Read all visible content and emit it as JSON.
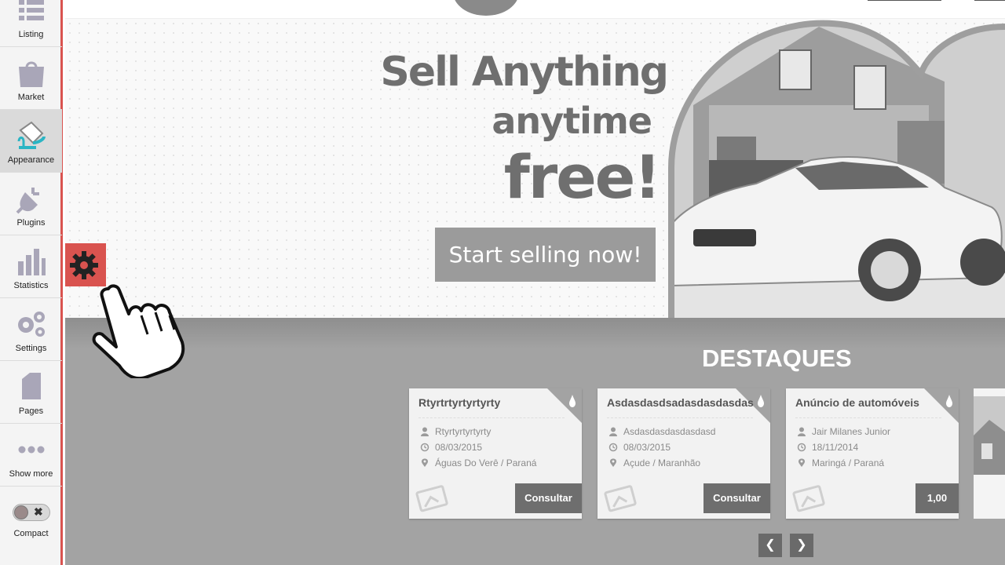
{
  "sidebar": {
    "items": [
      {
        "label": "Listing",
        "icon": "list-icon"
      },
      {
        "label": "Market",
        "icon": "shopping-bag-icon"
      },
      {
        "label": "Appearance",
        "icon": "paint-bucket-icon",
        "active": true
      },
      {
        "label": "Plugins",
        "icon": "plug-icon"
      },
      {
        "label": "Statistics",
        "icon": "bar-chart-icon"
      },
      {
        "label": "Settings",
        "icon": "gears-icon"
      },
      {
        "label": "Pages",
        "icon": "page-icon"
      },
      {
        "label": "Show more",
        "icon": "dots-icon"
      }
    ],
    "compact": {
      "label": "Compact",
      "toggle_symbol": "✖",
      "state": "off"
    }
  },
  "hero": {
    "line1": "Sell Anything",
    "line2": "anytime",
    "line3": "free!",
    "cta": "Start selling now!"
  },
  "featured": {
    "title": "DESTAQUES",
    "cards": [
      {
        "title": "Rtyrtrtyrtyrtyrty",
        "author": "Rtyrtyrtyrtyrty",
        "date": "08/03/2015",
        "location": "Águas Do Verê / Paraná",
        "action": "Consultar"
      },
      {
        "title": "Asdasdasdsadasdasdasdas",
        "author": "Asdasdasdasdasdasd",
        "date": "08/03/2015",
        "location": "Açude / Maranhão",
        "action": "Consultar"
      },
      {
        "title": "Anúncio de automóveis",
        "author": "Jair Milanes Junior",
        "date": "18/11/2014",
        "location": "Maringá / Paraná",
        "action": "1,00"
      }
    ],
    "prev": "❮",
    "next": "❯"
  },
  "colors": {
    "accent": "#d9534f",
    "sidebar_bg": "#f4f4f4",
    "featured_bg": "#a3a3a3",
    "button_dark": "#6e6e6e",
    "cta_bg": "#9b9b9b"
  }
}
